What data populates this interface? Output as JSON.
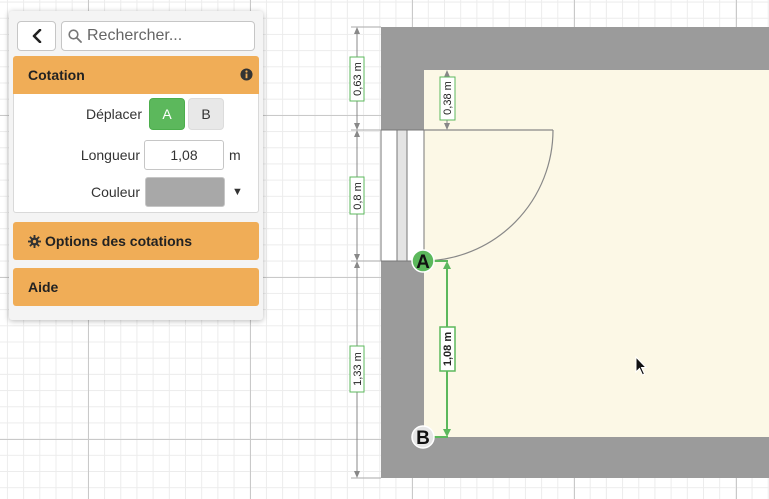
{
  "search": {
    "placeholder": "Rechercher..."
  },
  "panel": {
    "cotation": {
      "title": "Cotation",
      "move_label": "Déplacer",
      "move_point_a": "A",
      "move_point_b": "B",
      "selected_point": "A",
      "length_label": "Longueur",
      "length_value": "1,08",
      "length_unit": "m",
      "color_label": "Couleur",
      "color_value": "#a8a8a8"
    },
    "options_title": "Options des cotations",
    "help_title": "Aide"
  },
  "plan": {
    "dimensions": {
      "top_outer": "0,63 m",
      "top_inner": "0,38 m",
      "door_width": "0,8 m",
      "bottom_outer": "1,33 m",
      "selected": "1,08 m"
    },
    "points": {
      "a": "A",
      "b": "B"
    }
  },
  "colors": {
    "accent": "#f0ad57",
    "selected_button": "#5cb85c",
    "wall": "#9b9b9b",
    "floor": "#fcf8e6",
    "selected_dimension": "#5cb85c"
  }
}
